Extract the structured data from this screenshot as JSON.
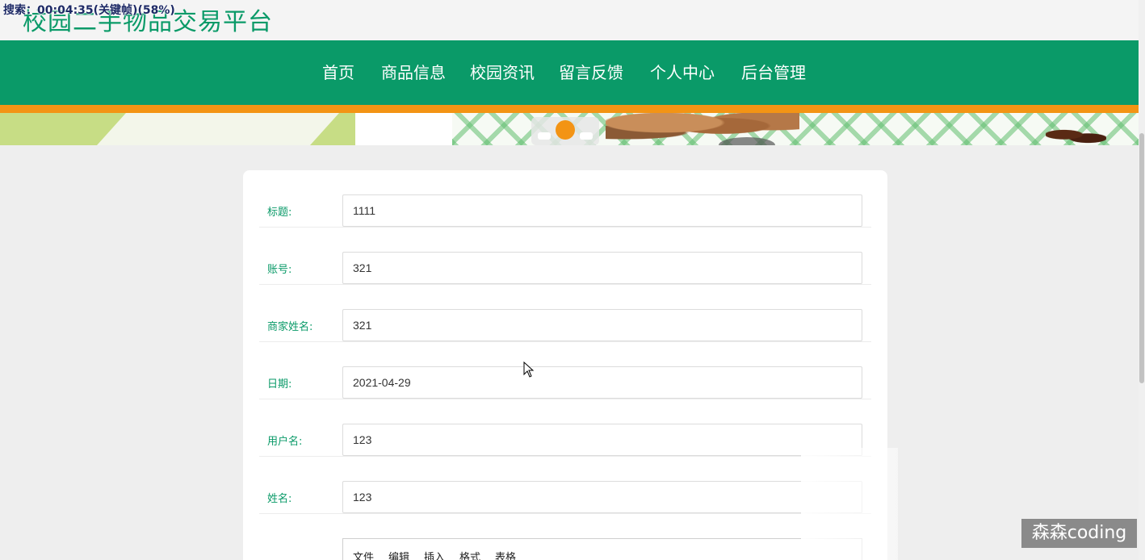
{
  "header": {
    "site_title": "校园二手物品交易平台",
    "search_overlay": "搜索：00:04:35(关键帧)(58%)"
  },
  "nav": {
    "items": [
      "首页",
      "商品信息",
      "校园资讯",
      "留言反馈",
      "个人中心",
      "后台管理"
    ]
  },
  "banner": {
    "active_slide": 2,
    "slide_count": 3
  },
  "form": {
    "fields": [
      {
        "label": "标题:",
        "value": "1111"
      },
      {
        "label": "账号:",
        "value": "321"
      },
      {
        "label": "商家姓名:",
        "value": "321"
      },
      {
        "label": "日期:",
        "value": "2021-04-29"
      },
      {
        "label": "用户名:",
        "value": "123"
      },
      {
        "label": "姓名:",
        "value": "123"
      }
    ],
    "editor_menu": [
      "文件",
      "编辑",
      "插入",
      "格式",
      "表格"
    ]
  },
  "watermark": "森森coding",
  "colors": {
    "brand_green": "#0a9a68",
    "accent_orange": "#f39414",
    "page_bg": "#eeeeee"
  }
}
